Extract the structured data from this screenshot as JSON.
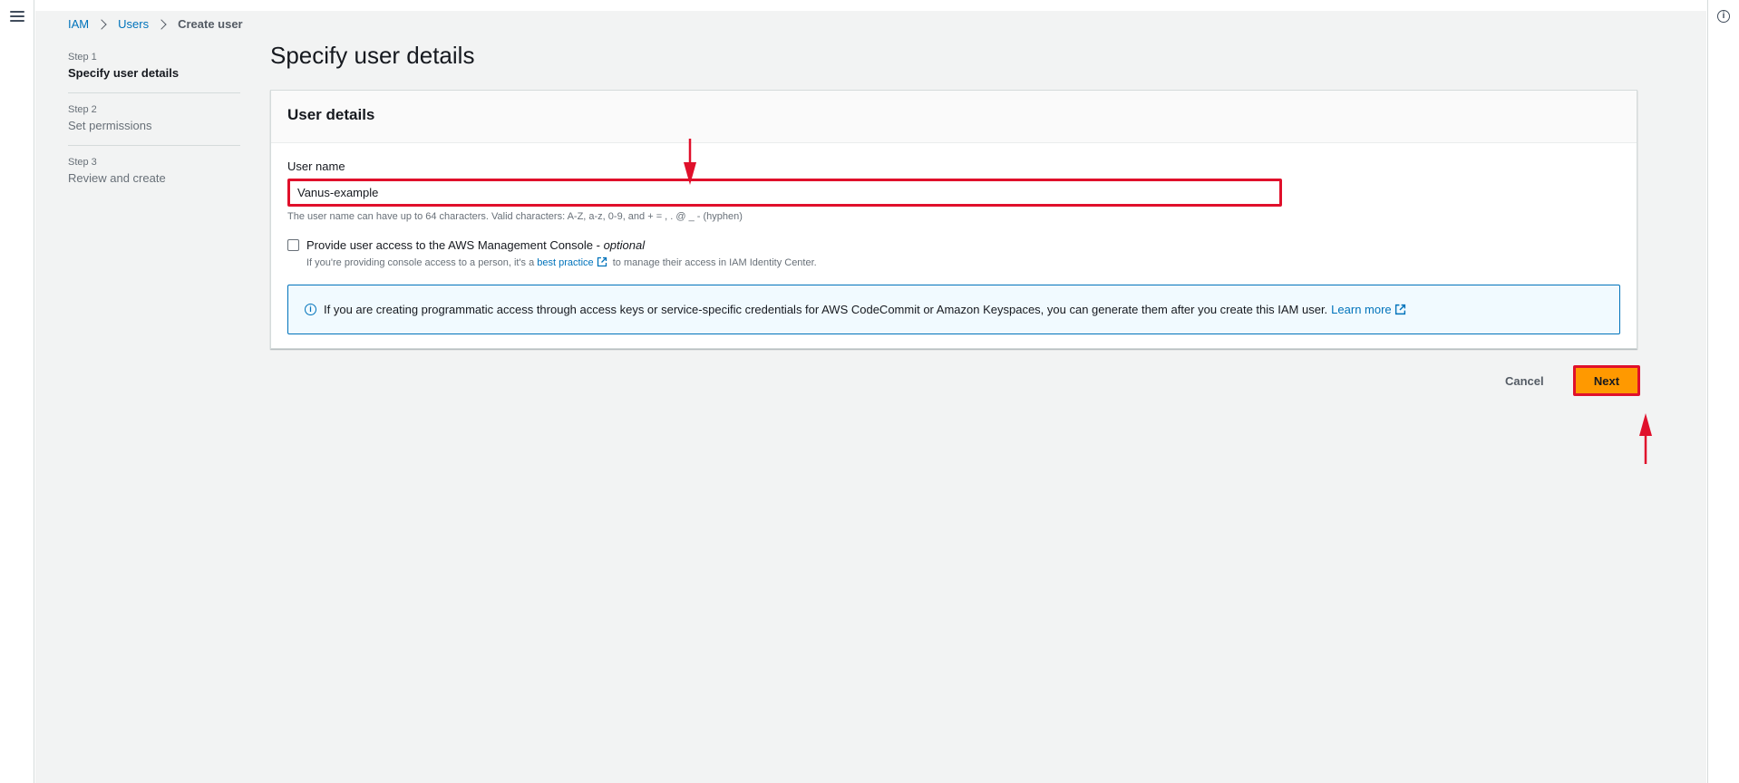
{
  "breadcrumb": {
    "items": [
      "IAM",
      "Users"
    ],
    "current": "Create user"
  },
  "steps": [
    {
      "num": "Step 1",
      "title": "Specify user details",
      "active": true
    },
    {
      "num": "Step 2",
      "title": "Set permissions",
      "active": false
    },
    {
      "num": "Step 3",
      "title": "Review and create",
      "active": false
    }
  ],
  "page": {
    "title": "Specify user details"
  },
  "panel": {
    "header": "User details",
    "username_label": "User name",
    "username_value": "Vanus-example",
    "username_hint": "The user name can have up to 64 characters. Valid characters: A-Z, a-z, 0-9, and + = , . @ _ - (hyphen)",
    "console_access_label": "Provide user access to the AWS Management Console - ",
    "console_access_optional": "optional",
    "console_sub_prefix": "If you're providing console access to a person, it's a ",
    "console_sub_link": "best practice",
    "console_sub_suffix": " to manage their access in IAM Identity Center.",
    "alert_text": "If you are creating programmatic access through access keys or service-specific credentials for AWS CodeCommit or Amazon Keyspaces, you can generate them after you create this IAM user.",
    "alert_link": "Learn more"
  },
  "actions": {
    "cancel": "Cancel",
    "next": "Next"
  },
  "icons": {
    "menu": "hamburger-menu-icon",
    "info": "info-icon",
    "external": "external-link-icon"
  },
  "colors": {
    "accent": "#ff9900",
    "link": "#0073bb",
    "highlight": "#e0102b"
  }
}
